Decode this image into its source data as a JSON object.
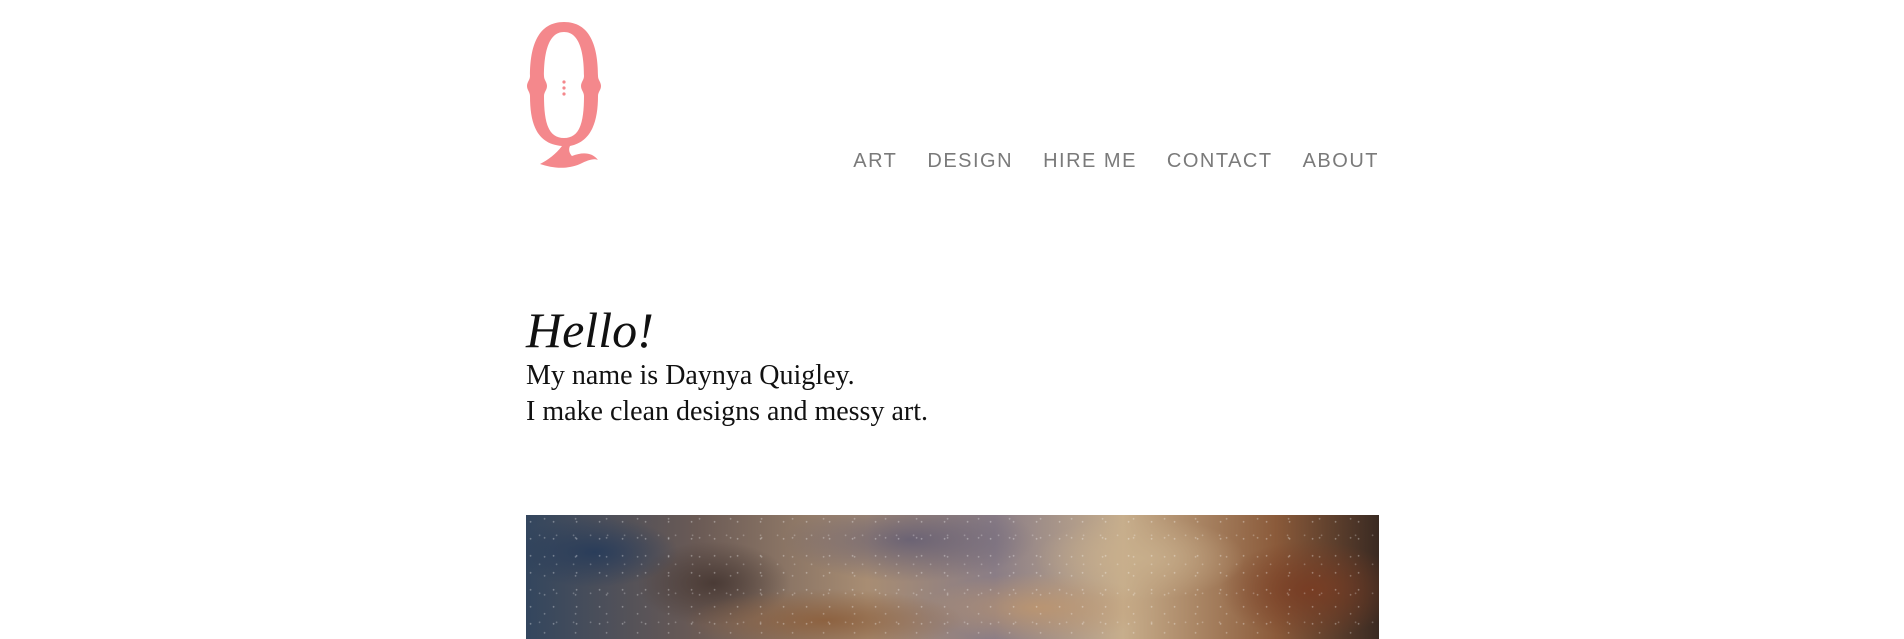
{
  "logo": {
    "letter": "Q",
    "icon": "q-monogram-logo",
    "color": "#f4888c"
  },
  "nav": {
    "items": [
      {
        "label": "ART"
      },
      {
        "label": "DESIGN"
      },
      {
        "label": "HIRE ME"
      },
      {
        "label": "CONTACT"
      },
      {
        "label": "ABOUT"
      }
    ],
    "color": "#7a7a7a"
  },
  "intro": {
    "greeting": "Hello!",
    "line1": "My name is Daynya Quigley.",
    "line2": "I make clean designs and messy art."
  },
  "hero": {
    "description_icon": "abstract-painting-image"
  }
}
